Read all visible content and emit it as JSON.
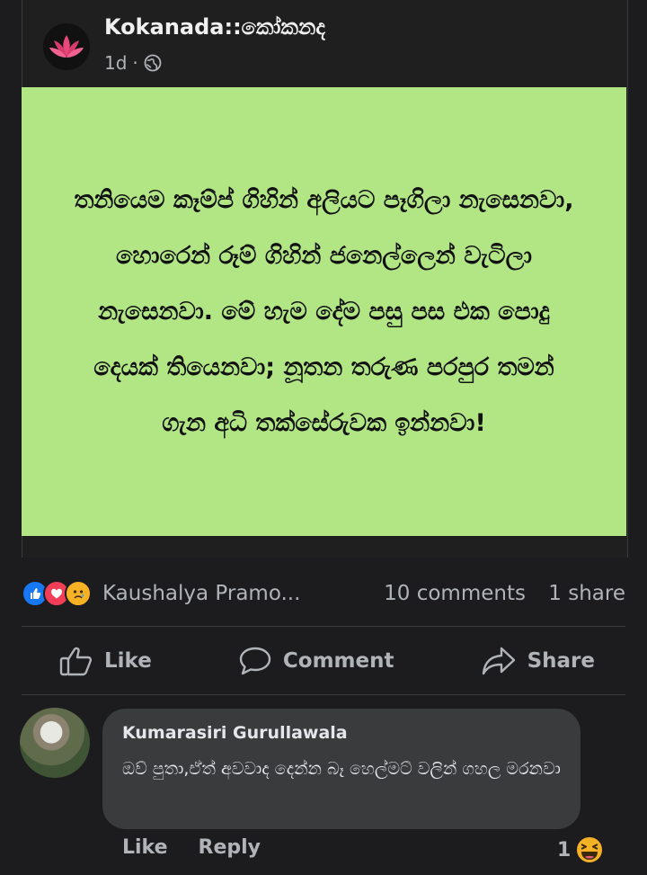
{
  "post": {
    "page_name": "Kokanada::කෝකනද",
    "time": "1d",
    "separator": "·",
    "privacy_icon": "globe-icon",
    "image_text": "තනියෙම කෑම්ප් ගිහින් අලියට පෑගිලා නැසෙනවා, හොරෙන් රූම් ගිහින් ජනෙල්ලෙන් වැටිලා නැසෙනවා. මේ හැම දේම පසු පස එක පොදු දෙයක් තියෙනවා; නූතන තරුණ පරපුර තමන් ගැන අධි තක්සේරුවක ඉන්නවා!",
    "image_bg": "#b2e684"
  },
  "reactions": {
    "icons": [
      "like-reaction-icon",
      "love-reaction-icon",
      "sad-reaction-icon"
    ],
    "names": "Kaushalya Pramo...",
    "comments": "10 comments",
    "shares": "1 share"
  },
  "actions": {
    "like": "Like",
    "comment": "Comment",
    "share": "Share"
  },
  "comment": {
    "author": "Kumarasiri Gurullawala",
    "text": "ඔව් පුතා,ඒත් අවවාද දෙන්න බෑ හෙල්මට් වලින් ගහල මරනවා",
    "like": "Like",
    "reply": "Reply",
    "reaction_count": "1",
    "reaction_icon": "laugh-reaction-icon"
  },
  "colors": {
    "background": "#1c1c1e",
    "bubble": "#3a3b3c",
    "muted_text": "#b0b3b8",
    "like_blue": "#1877f2",
    "love_red": "#f33e58",
    "haha_yellow": "#f7b125"
  }
}
